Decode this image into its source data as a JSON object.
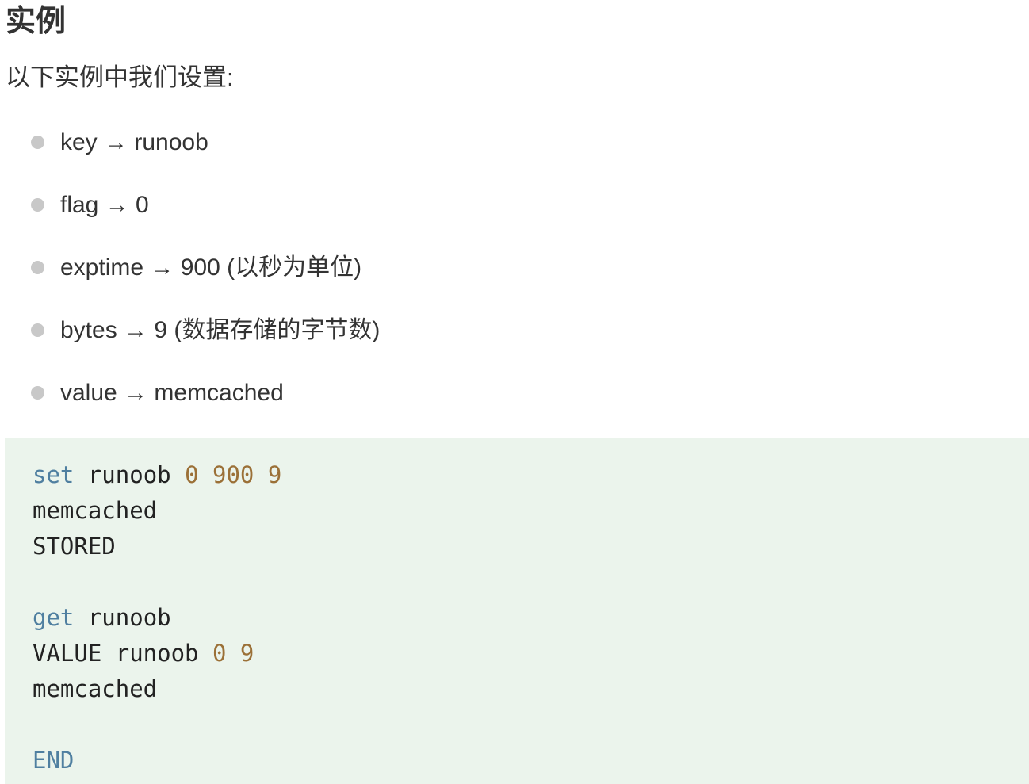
{
  "heading": "实例",
  "intro": "以下实例中我们设置:",
  "params": [
    "key → runoob",
    "flag → 0",
    "exptime → 900 (以秒为单位)",
    "bytes → 9 (数据存储的字节数)",
    "value → memcached"
  ],
  "code": {
    "line1": {
      "cmd": "set",
      "key": " runoob ",
      "flag": "0",
      "sp1": " ",
      "exptime": "900",
      "sp2": " ",
      "bytes": "9"
    },
    "line2": "memcached",
    "line3": "STORED",
    "line4": {
      "cmd": "get",
      "key": " runoob"
    },
    "line5": {
      "prefix": "VALUE runoob ",
      "flag": "0",
      "sp": " ",
      "bytes": "9"
    },
    "line6": "memcached",
    "line7": "END"
  },
  "colors": {
    "code_background": "#ebf4ec",
    "keyword": "#4f7fa0",
    "number": "#9b7037",
    "bullet": "#c8c8c8"
  }
}
